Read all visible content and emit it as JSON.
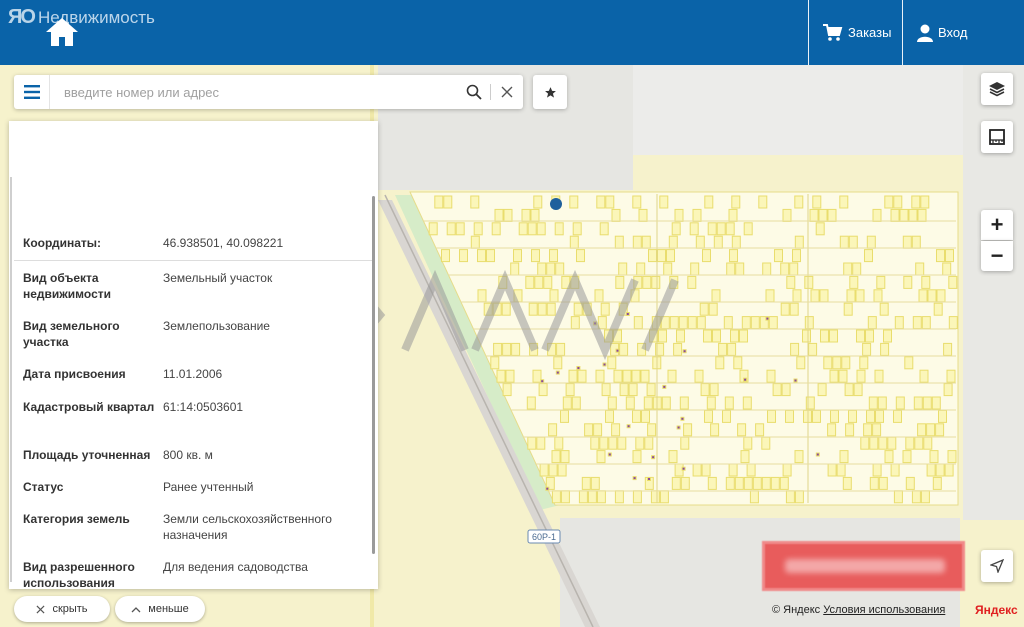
{
  "header": {
    "logo": "ЯО",
    "brand": "Недвижимость",
    "orders_label": "Заказы",
    "login_label": "Вход"
  },
  "search": {
    "placeholder": "введите номер или адрес"
  },
  "panel": {
    "rows": [
      {
        "label": "Координаты:",
        "value": "46.938501, 40.098221"
      },
      {
        "label": "Вид объекта недвижимости",
        "value": "Земельный участок"
      },
      {
        "label": "Вид земельного участка",
        "value": "Землепользование"
      },
      {
        "label": "Дата присвоения",
        "value": "11.01.2006"
      },
      {
        "label": "Кадастровый квартал",
        "value": "61:14:0503601"
      },
      {
        "label": "Площадь уточненная",
        "value": "800 кв. м"
      },
      {
        "label": "Статус",
        "value": "Ранее учтенный"
      },
      {
        "label": "Категория земель",
        "value": "Земли сельскохозяйственного назначения"
      },
      {
        "label": "Вид разрешенного использования",
        "value": "Для ведения садоводства"
      }
    ],
    "hide_label": "скрыть",
    "less_label": "меньше"
  },
  "map": {
    "road_label": "60Р-1",
    "zoom_in": "+",
    "zoom_out": "−",
    "copyright_prefix": "© Яндекс",
    "terms_link": "Условия использования",
    "yandex_logo": "Яндекс",
    "accent_color": "#0a63a8",
    "parcel_fill": "#fbf6b9",
    "parcel_stroke": "#e9dd6d"
  },
  "icons": {
    "home": "home-icon",
    "cart": "cart-icon",
    "user": "user-icon",
    "menu": "menu-icon",
    "search": "search-icon",
    "clear": "close-icon",
    "star": "star-icon",
    "layers": "layers-icon",
    "ruler": "ruler-icon",
    "locate": "locate-arrow-icon"
  }
}
